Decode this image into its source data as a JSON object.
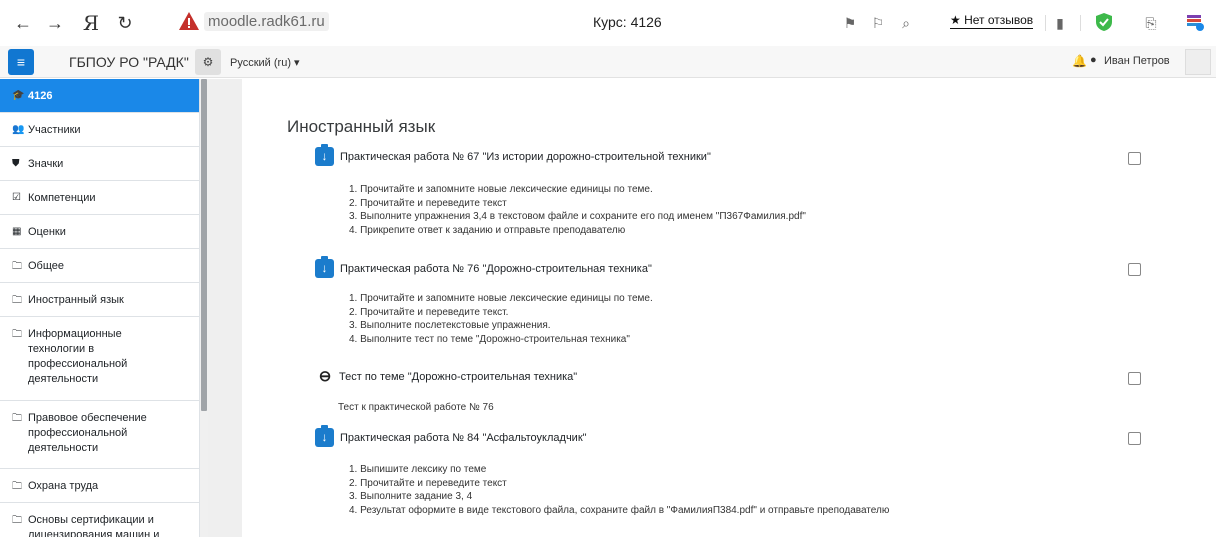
{
  "browser": {
    "back_icon": "←",
    "forward_icon": "→",
    "yandex_logo": "Я",
    "reload_icon": "↻",
    "url": "moodle.radk61.ru",
    "tab_title": "Курс: 4126",
    "reviews_label": "★ Нет отзывов"
  },
  "navbar": {
    "site_name": "ГБПОУ РО \"РАДК\"",
    "language": "Русский (ru) ▾",
    "user_name": "Иван Петров"
  },
  "sidebar": {
    "items": [
      {
        "icon": "graduation-cap",
        "glyph": "🎓",
        "label": "4126"
      },
      {
        "icon": "users",
        "glyph": "👥",
        "label": "Участники"
      },
      {
        "icon": "shield",
        "glyph": "⛊",
        "label": "Значки"
      },
      {
        "icon": "check-square",
        "glyph": "☑",
        "label": "Компетенции"
      },
      {
        "icon": "table",
        "glyph": "▦",
        "label": "Оценки"
      },
      {
        "icon": "folder",
        "glyph": "🗀",
        "label": "Общее"
      },
      {
        "icon": "folder",
        "glyph": "🗀",
        "label": "Иностранный язык"
      },
      {
        "icon": "folder",
        "glyph": "🗀",
        "label": "Информационные технологии в профессиональной деятельности"
      },
      {
        "icon": "folder",
        "glyph": "🗀",
        "label": "Правовое обеспечение профессиональной деятельности"
      },
      {
        "icon": "folder",
        "glyph": "🗀",
        "label": "Охрана труда"
      },
      {
        "icon": "folder",
        "glyph": "🗀",
        "label": "Основы сертификации и лицензирования машин и"
      }
    ]
  },
  "main": {
    "section_title": "Иностранный язык",
    "activities": [
      {
        "type": "assign",
        "title": "Практическая работа № 67 \"Из истории дорожно-строительной техники\"",
        "steps": [
          "1. Прочитайте и запомните новые лексические единицы по теме.",
          "2. Прочитайте и переведите текст",
          "3. Выполните упражнения 3,4 в текстовом файле и сохраните его под именем \"П367Фамилия.pdf\"",
          "4. Прикрепите ответ к заданию и отправьте преподавателю"
        ]
      },
      {
        "type": "assign",
        "title": "Практическая работа № 76 \"Дорожно-строительная техника\"",
        "steps": [
          "1. Прочитайте и запомните новые лексические единицы по теме.",
          "2. Прочитайте и переведите текст.",
          "3. Выполните послетекстовые упражнения.",
          "4. Выполните тест по теме \"Дорожно-строительная техника\""
        ]
      },
      {
        "type": "url",
        "title": "Тест по теме \"Дорожно-строительная техника\"",
        "description": "Тест к практической работе № 76"
      },
      {
        "type": "assign",
        "title": "Практическая работа № 84 \"Асфальтоукладчик\"",
        "steps": [
          "1. Выпишите лексику по теме",
          "2. Прочитайте и переведите текст",
          "3. Выполните задание 3, 4",
          "4. Результат оформите в виде текстового файла, сохраните файл в \"ФамилияП384.pdf\" и отправьте преподавателю"
        ]
      }
    ]
  },
  "colors": {
    "accent": "#1a88e8",
    "hamburger": "#1177d1",
    "assign_icon": "#1b7ccc"
  }
}
